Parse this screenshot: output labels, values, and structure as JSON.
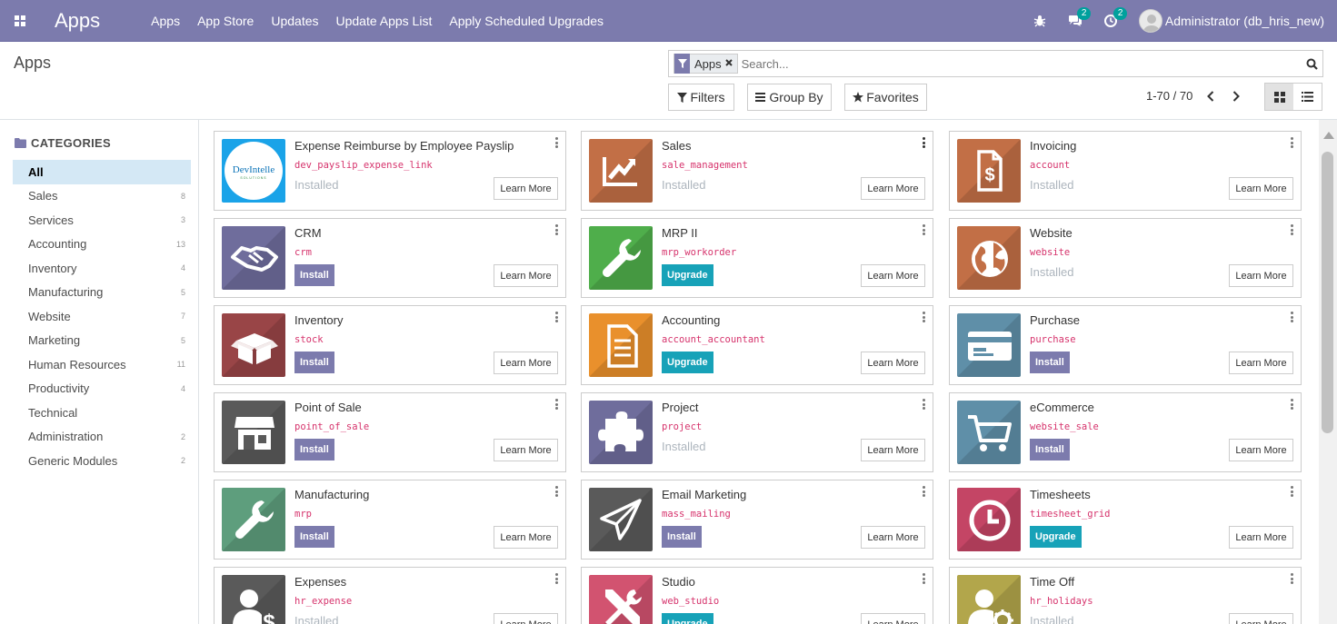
{
  "navbar": {
    "brand": "Apps",
    "menu": [
      "Apps",
      "App Store",
      "Updates",
      "Update Apps List",
      "Apply Scheduled Upgrades"
    ],
    "messages_badge": "2",
    "activity_badge": "2",
    "user": "Administrator (db_hris_new)",
    "color": "#7c7bad"
  },
  "control_panel": {
    "title": "Apps",
    "facet": "Apps",
    "search_placeholder": "Search...",
    "filters_label": "Filters",
    "groupby_label": "Group By",
    "favorites_label": "Favorites",
    "pager": "1-70 / 70"
  },
  "sidebar": {
    "header": "CATEGORIES",
    "items": [
      {
        "label": "All",
        "count": ""
      },
      {
        "label": "Sales",
        "count": "8"
      },
      {
        "label": "Services",
        "count": "3"
      },
      {
        "label": "Accounting",
        "count": "13"
      },
      {
        "label": "Inventory",
        "count": "4"
      },
      {
        "label": "Manufacturing",
        "count": "5"
      },
      {
        "label": "Website",
        "count": "7"
      },
      {
        "label": "Marketing",
        "count": "5"
      },
      {
        "label": "Human Resources",
        "count": "11"
      },
      {
        "label": "Productivity",
        "count": "4"
      },
      {
        "label": "Technical",
        "count": ""
      },
      {
        "label": "Administration",
        "count": "2"
      },
      {
        "label": "Generic Modules",
        "count": "2"
      }
    ]
  },
  "learn_more_label": "Learn More",
  "install_label": "Install",
  "upgrade_label": "Upgrade",
  "installed_label": "Installed",
  "apps": [
    {
      "name": "Expense Reimburse by Employee Payslip",
      "tech": "dev_payslip_expense_link",
      "state": "installed",
      "icon": "devintelle-logo",
      "logo_text": "DevIntelle",
      "logo_sub": "SOLUTIONS"
    },
    {
      "name": "Sales",
      "tech": "sale_management",
      "state": "installed",
      "icon": "sales-chart-icon",
      "color": "#c26f46"
    },
    {
      "name": "Invoicing",
      "tech": "account",
      "state": "installed",
      "icon": "invoice-icon",
      "color": "#c26f46"
    },
    {
      "name": "CRM",
      "tech": "crm",
      "state": "install",
      "icon": "handshake-icon",
      "color": "#6f6d9c"
    },
    {
      "name": "MRP II",
      "tech": "mrp_workorder",
      "state": "upgrade",
      "icon": "wrench-icon",
      "color": "#4fae4b"
    },
    {
      "name": "Website",
      "tech": "website",
      "state": "installed",
      "icon": "globe-icon",
      "color": "#c26f46"
    },
    {
      "name": "Inventory",
      "tech": "stock",
      "state": "install",
      "icon": "box-icon",
      "color": "#994547"
    },
    {
      "name": "Accounting",
      "tech": "account_accountant",
      "state": "upgrade",
      "icon": "document-icon",
      "color": "#e9902c"
    },
    {
      "name": "Purchase",
      "tech": "purchase",
      "state": "install",
      "icon": "credit-card-icon",
      "color": "#5f8fa8"
    },
    {
      "name": "Point of Sale",
      "tech": "point_of_sale",
      "state": "install",
      "icon": "shop-icon",
      "color": "#5a5a5a"
    },
    {
      "name": "Project",
      "tech": "project",
      "state": "installed",
      "icon": "puzzle-icon",
      "color": "#6f6d9c"
    },
    {
      "name": "eCommerce",
      "tech": "website_sale",
      "state": "install",
      "icon": "cart-icon",
      "color": "#5f8fa8"
    },
    {
      "name": "Manufacturing",
      "tech": "mrp",
      "state": "install",
      "icon": "wrench-icon",
      "color": "#5e9e7d"
    },
    {
      "name": "Email Marketing",
      "tech": "mass_mailing",
      "state": "install",
      "icon": "paper-plane-icon",
      "color": "#5a5a5a"
    },
    {
      "name": "Timesheets",
      "tech": "timesheet_grid",
      "state": "upgrade",
      "icon": "clock-icon",
      "color": "#c44565"
    },
    {
      "name": "Expenses",
      "tech": "hr_expense",
      "state": "installed",
      "icon": "user-dollar-icon",
      "color": "#5a5a5a"
    },
    {
      "name": "Studio",
      "tech": "web_studio",
      "state": "upgrade",
      "icon": "tools-icon",
      "color": "#d25370"
    },
    {
      "name": "Time Off",
      "tech": "hr_holidays",
      "state": "installed",
      "icon": "user-gear-icon",
      "color": "#b2a64b"
    }
  ]
}
